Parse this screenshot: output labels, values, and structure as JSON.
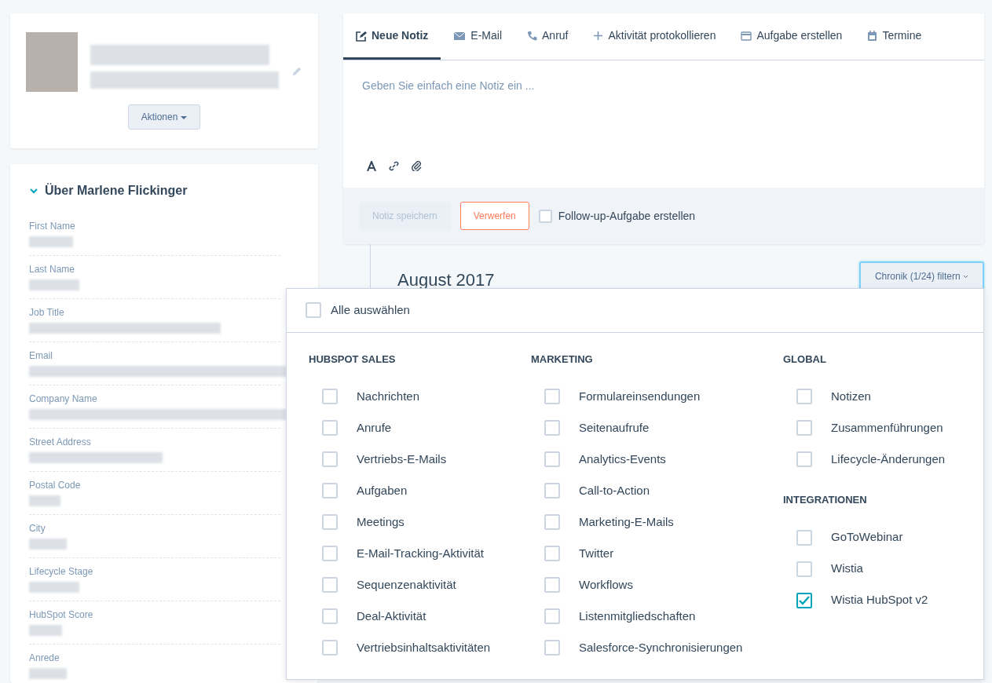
{
  "profile": {
    "actions_button": "Aktionen"
  },
  "about": {
    "title": "Über Marlene Flickinger",
    "expanded": true,
    "fields": [
      {
        "label": "First Name"
      },
      {
        "label": "Last Name"
      },
      {
        "label": "Job Title"
      },
      {
        "label": "Email"
      },
      {
        "label": "Company Name"
      },
      {
        "label": "Street Address"
      },
      {
        "label": "Postal Code"
      },
      {
        "label": "City"
      },
      {
        "label": "Lifecycle Stage"
      },
      {
        "label": "HubSpot Score"
      },
      {
        "label": "Anrede"
      }
    ]
  },
  "composer": {
    "tabs": [
      {
        "label": "Neue Notiz",
        "selected": true
      },
      {
        "label": "E-Mail",
        "selected": false
      },
      {
        "label": "Anruf",
        "selected": false
      },
      {
        "label": "Aktivität protokollieren",
        "selected": false
      },
      {
        "label": "Aufgabe erstellen",
        "selected": false
      },
      {
        "label": "Termine",
        "selected": false
      }
    ],
    "placeholder": "Geben Sie einfach eine Notiz ein ...",
    "save_button": {
      "label": "Notiz speichern",
      "disabled": true
    },
    "discard_button": "Verwerfen",
    "followup": {
      "label": "Follow-up-Aufgabe erstellen",
      "checked": false
    }
  },
  "timeline": {
    "month": "August 2017",
    "filter_button": "Chronik (1/24) filtern"
  },
  "filter": {
    "select_all": {
      "label": "Alle auswählen",
      "checked": false
    },
    "columns": [
      {
        "groups": [
          {
            "heading": "HUBSPOT SALES",
            "items": [
              {
                "label": "Nachrichten",
                "checked": false
              },
              {
                "label": "Anrufe",
                "checked": false
              },
              {
                "label": "Vertriebs-E-Mails",
                "checked": false
              },
              {
                "label": "Aufgaben",
                "checked": false
              },
              {
                "label": "Meetings",
                "checked": false
              },
              {
                "label": "E-Mail-Tracking-Aktivität",
                "checked": false
              },
              {
                "label": "Sequenzenaktivität",
                "checked": false
              },
              {
                "label": "Deal-Aktivität",
                "checked": false
              },
              {
                "label": "Vertriebsinhaltsaktivitäten",
                "checked": false
              }
            ]
          }
        ]
      },
      {
        "groups": [
          {
            "heading": "MARKETING",
            "items": [
              {
                "label": "Formulareinsendungen",
                "checked": false
              },
              {
                "label": "Seitenaufrufe",
                "checked": false
              },
              {
                "label": "Analytics-Events",
                "checked": false
              },
              {
                "label": "Call-to-Action",
                "checked": false
              },
              {
                "label": "Marketing-E-Mails",
                "checked": false
              },
              {
                "label": "Twitter",
                "checked": false
              },
              {
                "label": "Workflows",
                "checked": false
              },
              {
                "label": "Listenmitgliedschaften",
                "checked": false
              },
              {
                "label": "Salesforce-Synchronisierungen",
                "checked": false
              }
            ]
          }
        ]
      },
      {
        "groups": [
          {
            "heading": "GLOBAL",
            "items": [
              {
                "label": "Notizen",
                "checked": false
              },
              {
                "label": "Zusammenführungen",
                "checked": false
              },
              {
                "label": "Lifecycle-Änderungen",
                "checked": false
              }
            ]
          },
          {
            "heading": "INTEGRATIONEN",
            "items": [
              {
                "label": "GoToWebinar",
                "checked": false
              },
              {
                "label": "Wistia",
                "checked": false
              },
              {
                "label": "Wistia HubSpot v2",
                "checked": true
              }
            ]
          }
        ]
      }
    ]
  }
}
